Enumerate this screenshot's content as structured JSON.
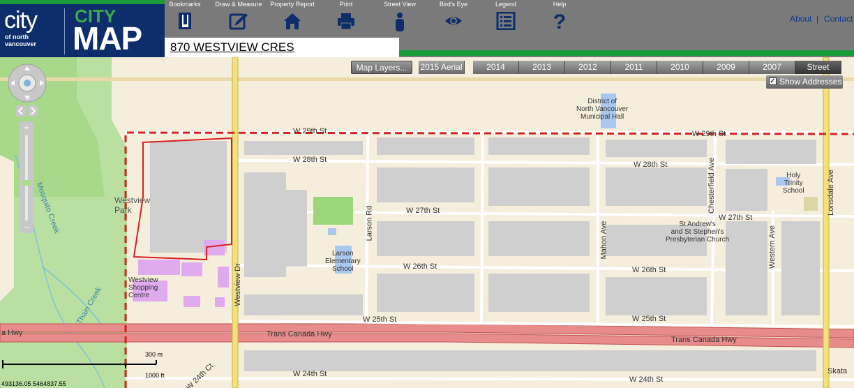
{
  "logo": {
    "city": "city",
    "sub": "of north vancouver",
    "map_top": "CITY",
    "map": "MAP"
  },
  "toolbar": [
    {
      "id": "bookmarks",
      "label": "Bookmarks",
      "icon": "bookmark-icon"
    },
    {
      "id": "draw",
      "label": "Draw & Measure",
      "icon": "pencil-icon"
    },
    {
      "id": "report",
      "label": "Property Report",
      "icon": "house-icon"
    },
    {
      "id": "print",
      "label": "Print",
      "icon": "printer-icon"
    },
    {
      "id": "streetview",
      "label": "Street View",
      "icon": "person-icon"
    },
    {
      "id": "birdseye",
      "label": "Bird's Eye",
      "icon": "eye-icon"
    },
    {
      "id": "legend",
      "label": "Legend",
      "icon": "list-icon"
    },
    {
      "id": "help",
      "label": "Help",
      "icon": "question-icon"
    }
  ],
  "links": {
    "about": "About",
    "separator": "|",
    "contact": "Contact"
  },
  "address": "870 WESTVIEW CRES",
  "map_controls": {
    "layers": "Map Layers...",
    "years": [
      "2015 Aerial",
      "2014",
      "2013",
      "2012",
      "2011",
      "2010",
      "2009",
      "2007",
      "Street"
    ],
    "active_year": "Street",
    "show_addresses": "Show Addresses",
    "show_addresses_checked": true
  },
  "map_labels": {
    "w29a": "W 29th St",
    "w29b": "W 29th St",
    "w28a": "W 28th St",
    "w28b": "W 28th St",
    "w27a": "W 27th St",
    "w27b": "W 27th St",
    "w26a": "W 26th St",
    "w26b": "W 26th St",
    "w25a": "W 25th St",
    "w25b": "W 25th St",
    "tch1": "Trans Canada Hwy",
    "tch2": "Trans Canada Hwy",
    "hwy_left": "a Hwy",
    "w24a": "W 24th St",
    "w24b": "W 24th St",
    "w24c": "W 24th Ct",
    "larson": "Larson Rd",
    "westview": "Westview Dr",
    "mahon": "Mahon Ave",
    "chesterfield": "Chesterfield Ave",
    "western": "Western Ave",
    "lonsdale": "Lonsdale Ave",
    "westview_park": "Westview\nPark",
    "mosquito": "Mosquito Creek",
    "thain": "Thain Creek",
    "municipal": "District of\nNorth Vancouver\nMunicipal Hall",
    "larson_school": "Larson\nElementary\nSchool",
    "holy_trinity": "Holy\nTrinity\nSchool",
    "church": "St Andrew's\nand St Stephen's\nPresbyterian Church",
    "shopping": "Westview\nShopping\nCentre",
    "skate": "Skata"
  },
  "scale": {
    "metric": "300 m",
    "imperial": "1000 ft"
  },
  "coordinates": "493136.05 5464837.55",
  "colors": {
    "header_gray": "#7a7a7a",
    "logo_blue": "#0d2d6b",
    "accent_green": "#1a9b3a",
    "boundary_red": "#d42020",
    "park_green": "#a8d88a",
    "road_yellow": "#f2e27a",
    "highway_red": "#e06a6a"
  }
}
